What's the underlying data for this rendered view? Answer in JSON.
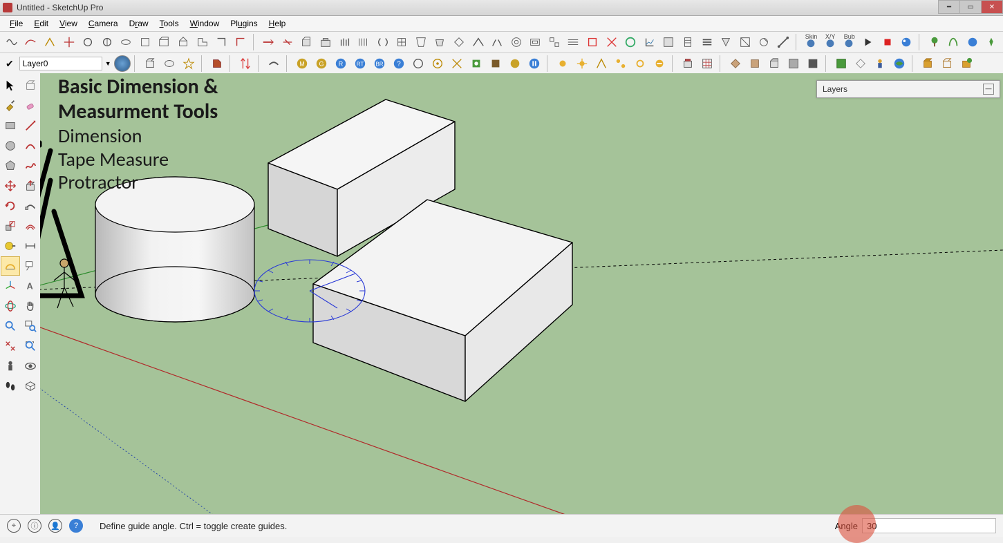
{
  "window": {
    "title": "Untitled - SketchUp Pro"
  },
  "menus": [
    "File",
    "Edit",
    "View",
    "Camera",
    "Draw",
    "Tools",
    "Window",
    "Plugins",
    "Help"
  ],
  "layer": {
    "current": "Layer0"
  },
  "toolbar_labels": {
    "skin": "Skin",
    "xy": "X/Y",
    "bub": "Bub"
  },
  "panel": {
    "layers_title": "Layers"
  },
  "status": {
    "hint": "Define guide angle.  Ctrl = toggle create guides.",
    "vcb_label": "Angle",
    "vcb_value": "30"
  },
  "annotation": {
    "title1": "Basic Dimension &",
    "title2": "Measurment Tools",
    "line1": "Dimension",
    "line2": "Tape Measure",
    "line3": "Protractor"
  }
}
